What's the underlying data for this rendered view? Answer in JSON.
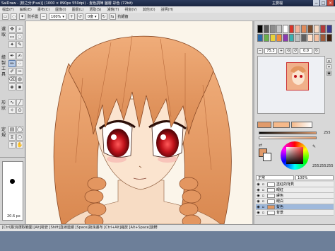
{
  "titlebar": {
    "title": "SaiDraw - [梳之分(F.sai)] (1000 × 890px 550dpi) - 髮色調陣 圖層 彩色 (72bit)",
    "right_label": "主要檔",
    "buttons": [
      "−",
      "□",
      "×"
    ]
  },
  "menubar": {
    "items": [
      "檔案(F)",
      "編輯(E)",
      "畫布(C)",
      "圖像(I)",
      "圖層(L)",
      "選取(S)",
      "濾鏡(T)",
      "視窗(V)",
      "其他(O)",
      "說明(H)"
    ]
  },
  "options": {
    "zoom": "100%",
    "angle": "0度",
    "mode_label": "抗鋸齒",
    "stabilizer": "防手震"
  },
  "toolbox": {
    "labels": [
      "選",
      "取",
      "繪",
      "製",
      "工",
      "具",
      "形",
      "狀",
      "定",
      "規"
    ]
  },
  "brush": {
    "size": "20.6 px"
  },
  "colors": {
    "palette": [
      "#000000",
      "#5a5a5a",
      "#8c8c8c",
      "#c8c8c8",
      "#ffffff",
      "#d9352a",
      "#f2b29a",
      "#e08a5a",
      "#7a4a2a",
      "#f7d9c2",
      "#b23a3a",
      "#3a3a8c",
      "#2a6aa8",
      "#6ab04a",
      "#e8d23a",
      "#f28c3a",
      "#8c3ab0",
      "#3ab0b0",
      "#c0c0c0",
      "#606060",
      "#ffe0c8",
      "#f5c0a0",
      "#a05a3a",
      "#402010"
    ],
    "foreground": "#e09a6a",
    "secondary": "#f5b98a",
    "bar_value": "255",
    "r": "255",
    "g": "255",
    "b": "255"
  },
  "navigator": {
    "zoom_value": "75.3",
    "angle_value": "0.0"
  },
  "layers": {
    "mode": "正常",
    "opacity": "100%",
    "items": [
      {
        "name": "塗紅的背貝",
        "active": false
      },
      {
        "name": "眼紅",
        "active": false
      },
      {
        "name": "膚色",
        "active": false
      },
      {
        "name": "眼白",
        "active": false
      },
      {
        "name": "髮色",
        "active": true
      },
      {
        "name": "背景",
        "active": false
      }
    ]
  },
  "statusbar": {
    "text": "[Ctrl]取消選取範圍 [Alt]吸管 [Shift]直線連續 [Space]拖曳畫布 [Ctrl+Alt]縮放 [Alt+Space]旋轉"
  }
}
